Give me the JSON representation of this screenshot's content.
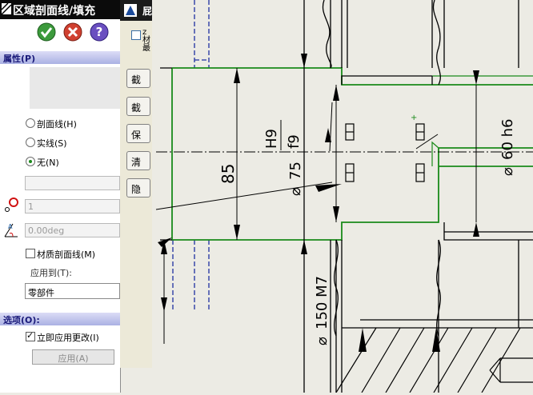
{
  "panel": {
    "title": "区域剖面线/填充",
    "toolbar": {
      "ok": "OK",
      "cancel": "Cancel",
      "help": "?"
    },
    "properties_header": "属性(P)",
    "radios": [
      {
        "label": "剖面线(H)",
        "selected": false
      },
      {
        "label": "实线(S)",
        "selected": false
      },
      {
        "label": "无(N)",
        "selected": true
      }
    ],
    "scale_value": "1",
    "angle_value": "0.00deg",
    "material_hatch_label": "材质剖面线(M)",
    "material_hatch_checked": false,
    "apply_to_label": "应用到(T):",
    "apply_to_value": "零部件",
    "options_header": "选项(O):",
    "apply_immediately_label": "立即应用更改(I)",
    "apply_immediately_checked": true,
    "apply_button": "应用(A)"
  },
  "window2": {
    "title_fragment": "屁",
    "checkbox_text": "z\n材\n最",
    "buttons": [
      "截",
      "截",
      "保",
      "清",
      "隐"
    ]
  },
  "drawing": {
    "dims": {
      "height": "85",
      "fit_upper": "H9",
      "fit_lower": "f9",
      "diameter": "75",
      "shaft": "60 h6",
      "lower": "150 M7"
    },
    "colors": {
      "outline": "#1a8a1a",
      "hidden": "#1f2fa0",
      "lines": "#000000"
    }
  }
}
